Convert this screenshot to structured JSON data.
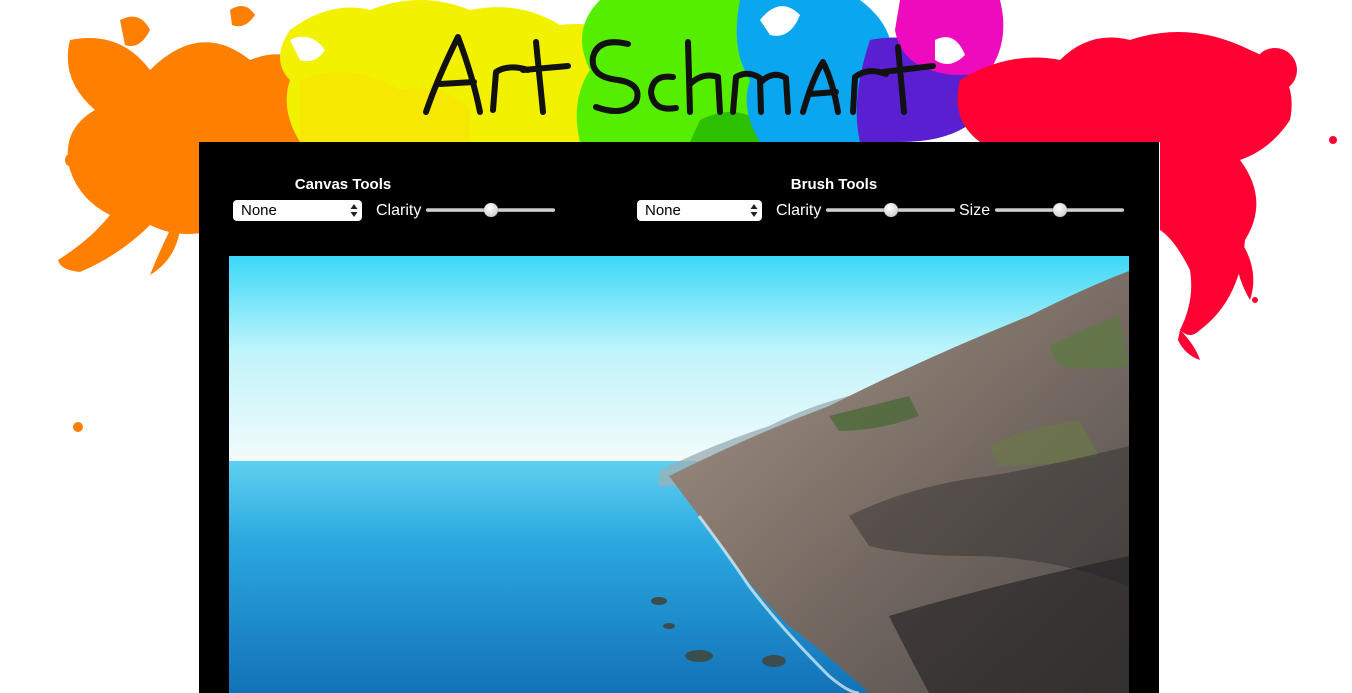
{
  "site": {
    "title": "Art Schmart"
  },
  "canvas_tools": {
    "title": "Canvas Tools",
    "mode_selected": "None",
    "clarity_label": "Clarity",
    "clarity_value": 0.5
  },
  "brush_tools": {
    "title": "Brush Tools",
    "mode_selected": "None",
    "clarity_label": "Clarity",
    "clarity_value": 0.5,
    "size_label": "Size",
    "size_value": 0.5
  },
  "colors": {
    "panel": "#000000",
    "splash_orange": "#ff7f00",
    "splash_yellow": "#f2f200",
    "splash_green": "#55ee00",
    "splash_blue": "#0aa6f0",
    "splash_purple": "#5a1fd0",
    "splash_magenta": "#ee0bbd",
    "splash_red": "#ff0033"
  }
}
